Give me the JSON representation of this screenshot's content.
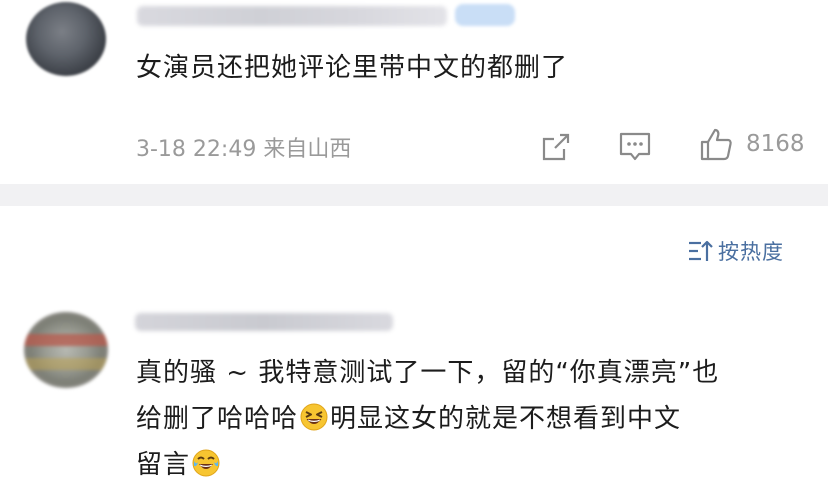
{
  "comment1": {
    "username": "",
    "text": "女演员还把她评论里带中文的都删了",
    "meta": "3-18 22:49 来自山西",
    "like_count": "8168",
    "icons": [
      "share-icon",
      "reply-icon",
      "like-icon"
    ]
  },
  "sort": {
    "label": "按热度",
    "icon": "sort-icon"
  },
  "comment2": {
    "username": "",
    "line1": "真的骚 ~ 我特意测试了一下，留的“你真漂亮”也",
    "line2_a": "给删了哈哈哈",
    "line2_b": "明显这女的就是不想看到中文",
    "line3_a": "留言",
    "emojis": [
      "grinning-squint-emoji",
      "tears-of-joy-emoji"
    ]
  },
  "colors": {
    "text": "#1c1c1c",
    "meta": "#9a9a9a",
    "link_blue": "#4a6fa0",
    "separator": "#f1f1f3"
  }
}
